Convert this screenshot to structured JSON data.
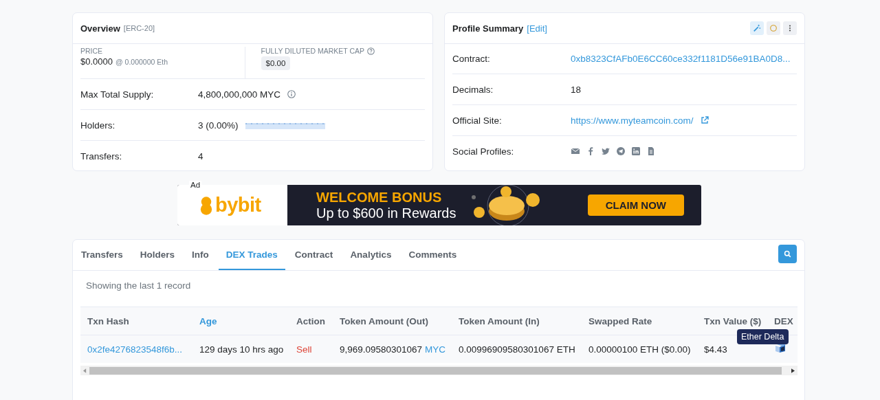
{
  "overview": {
    "title": "Overview",
    "tag": "[ERC-20]",
    "price_label": "PRICE",
    "price": "$0.0000",
    "price_eth": "@ 0.000000 Eth",
    "market_cap_label": "FULLY DILUTED MARKET CAP",
    "market_cap": "$0.00",
    "rows": [
      {
        "label": "Max Total Supply:",
        "value": "4,800,000,000 MYC",
        "kind": "info"
      },
      {
        "label": "Holders:",
        "value": "3 (0.00%)",
        "kind": "sparkline"
      },
      {
        "label": "Transfers:",
        "value": "4",
        "kind": "plain"
      }
    ]
  },
  "profile": {
    "title": "Profile Summary",
    "edit": "[Edit]",
    "rows": [
      {
        "label": "Contract:",
        "value": "0xb8323CfAFb0E6CC60ce332f1181D56e91BA0D8...",
        "kind": "link"
      },
      {
        "label": "Decimals:",
        "value": "18",
        "kind": "plain"
      },
      {
        "label": "Official Site:",
        "value": "https://www.myteamcoin.com/",
        "kind": "external"
      },
      {
        "label": "Social Profiles:",
        "kind": "socials"
      }
    ]
  },
  "ad": {
    "label": "Ad",
    "brand": "bybit",
    "headline": "WELCOME BONUS",
    "subline": "Up to $600 in Rewards",
    "cta": "CLAIM NOW"
  },
  "tabs": [
    {
      "label": "Transfers",
      "selected": false
    },
    {
      "label": "Holders",
      "selected": false
    },
    {
      "label": "Info",
      "selected": false
    },
    {
      "label": "DEX Trades",
      "selected": true
    },
    {
      "label": "Contract",
      "selected": false
    },
    {
      "label": "Analytics",
      "selected": false
    },
    {
      "label": "Comments",
      "selected": false
    }
  ],
  "record_note": "Showing the last 1 record",
  "table": {
    "columns": [
      {
        "label": "Txn Hash",
        "sortable": false
      },
      {
        "label": "Age",
        "sortable": true
      },
      {
        "label": "Action",
        "sortable": false
      },
      {
        "label": "Token Amount (Out)",
        "sortable": false
      },
      {
        "label": "Token Amount (In)",
        "sortable": false
      },
      {
        "label": "Swapped Rate",
        "sortable": false
      },
      {
        "label": "Txn Value ($)",
        "sortable": false
      },
      {
        "label": "DEX",
        "sortable": false
      }
    ],
    "rows": [
      {
        "txn_hash": "0x2fe4276823548f6b...",
        "age": "129 days 10 hrs ago",
        "action": "Sell",
        "amount_out": "9,969.09580301067",
        "amount_out_token": "MYC",
        "amount_in": "0.00996909580301067 ETH",
        "swapped_rate": "0.00000100 ETH ($0.00)",
        "txn_value": "$4.43",
        "dex_tooltip": "Ether Delta"
      }
    ]
  }
}
